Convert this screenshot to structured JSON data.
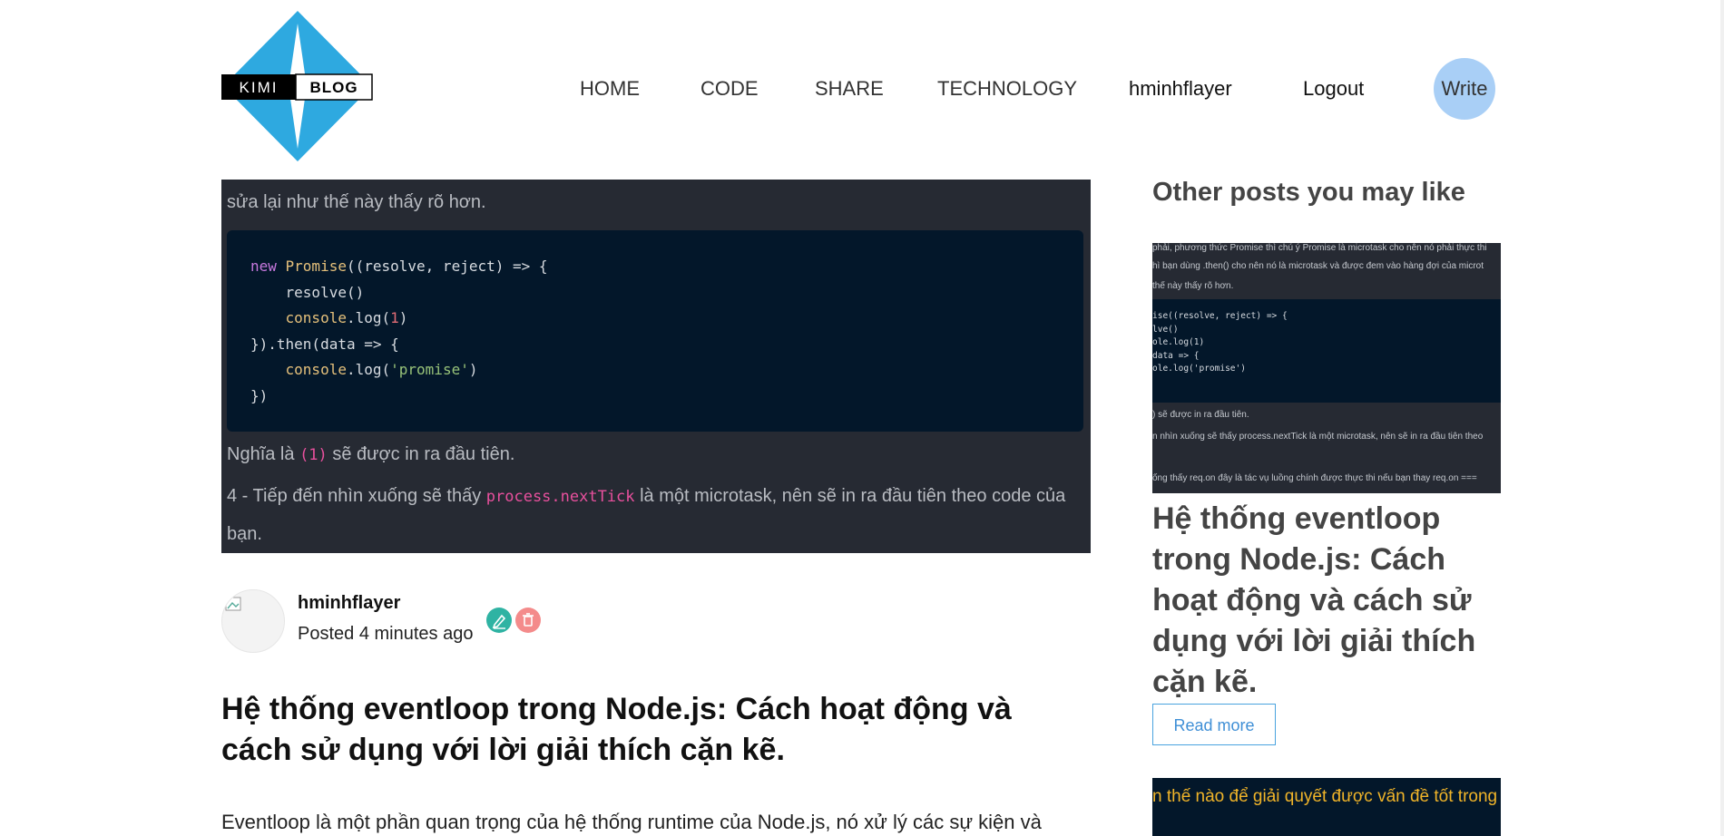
{
  "header": {
    "logo_text_left": "KIMI",
    "logo_text_right": "BLOG",
    "nav": [
      "HOME",
      "CODE",
      "SHARE",
      "TECHNOLOGY",
      "hminhflayer",
      "Logout"
    ],
    "write_label": "Write"
  },
  "article": {
    "para1": "sửa lại như thế này thấy rõ hơn.",
    "code": [
      {
        "tokens": [
          {
            "t": "new ",
            "c": "kw"
          },
          {
            "t": "Promise",
            "c": "cls"
          },
          {
            "t": "((resolve, reject) => {",
            "c": ""
          }
        ]
      },
      {
        "tokens": [
          {
            "t": "    resolve()",
            "c": ""
          }
        ]
      },
      {
        "tokens": [
          {
            "t": "    ",
            "c": ""
          },
          {
            "t": "console",
            "c": "cls"
          },
          {
            "t": ".log(",
            "c": ""
          },
          {
            "t": "1",
            "c": "num"
          },
          {
            "t": ")",
            "c": ""
          }
        ]
      },
      {
        "tokens": [
          {
            "t": "}).then(data => {",
            "c": ""
          }
        ]
      },
      {
        "tokens": [
          {
            "t": "    ",
            "c": ""
          },
          {
            "t": "console",
            "c": "cls"
          },
          {
            "t": ".log(",
            "c": ""
          },
          {
            "t": "'promise'",
            "c": "str"
          },
          {
            "t": ")",
            "c": ""
          }
        ]
      },
      {
        "tokens": [
          {
            "t": "})",
            "c": ""
          }
        ]
      }
    ],
    "para2_pre": "Nghĩa là ",
    "para2_code": "(1)",
    "para2_post": " sẽ được in ra đầu tiên.",
    "para3_pre": "4 - Tiếp đến nhìn xuống sẽ thấy ",
    "para3_code": "process.nextTick",
    "para3_post": " là một microtask, nên sẽ in ra đầu tiên theo code của",
    "para3_line2": "bạn."
  },
  "author": {
    "name": "hminhflayer",
    "posted": "Posted 4 minutes ago"
  },
  "post": {
    "title": "Hệ thống eventloop trong Node.js: Cách hoạt động và cách sử dụng với lời giải thích cặn kẽ.",
    "excerpt": "Eventloop là một phần quan trọng của hệ thống runtime của Node.js, nó xử lý các sự kiện và"
  },
  "sidebar": {
    "heading": "Other posts you may like",
    "thumb_lines_top": [
      "phải, phương thức Promise thì chú ý Promise là microtask cho nên nó phải thực thi",
      "hì bạn dùng .then() cho nên nó là microtask và được đem vào hàng đợi của microt",
      "thế này thấy rõ hơn."
    ],
    "thumb_code": "ise((resolve, reject) => {\nlve()\nole.log(1)\ndata => {\nole.log('promise')",
    "thumb_lines_bottom": [
      ") sẽ được in ra đầu tiên.",
      "n nhìn xuống sẽ thấy process.nextTick là một microtask, nên sẽ in ra đầu tiên theo",
      "ống thấy req.on đây là tác vụ luồng chính được thực thi nếu bạn thay req.on ==="
    ],
    "post_title": "Hệ thống eventloop trong Node.js: Cách hoạt động và cách sử dụng với lời giải thích cặn kẽ.",
    "read_more": "Read more",
    "thumb2_text": "n thế nào để giải quyết được vấn đề tốt trong l"
  },
  "colors": {
    "logo_blue": "#2ea9e0",
    "write_bg": "#a9cff6",
    "code_bg": "#03172a",
    "article_bg": "#262a33",
    "inline_code": "#e8509d"
  }
}
